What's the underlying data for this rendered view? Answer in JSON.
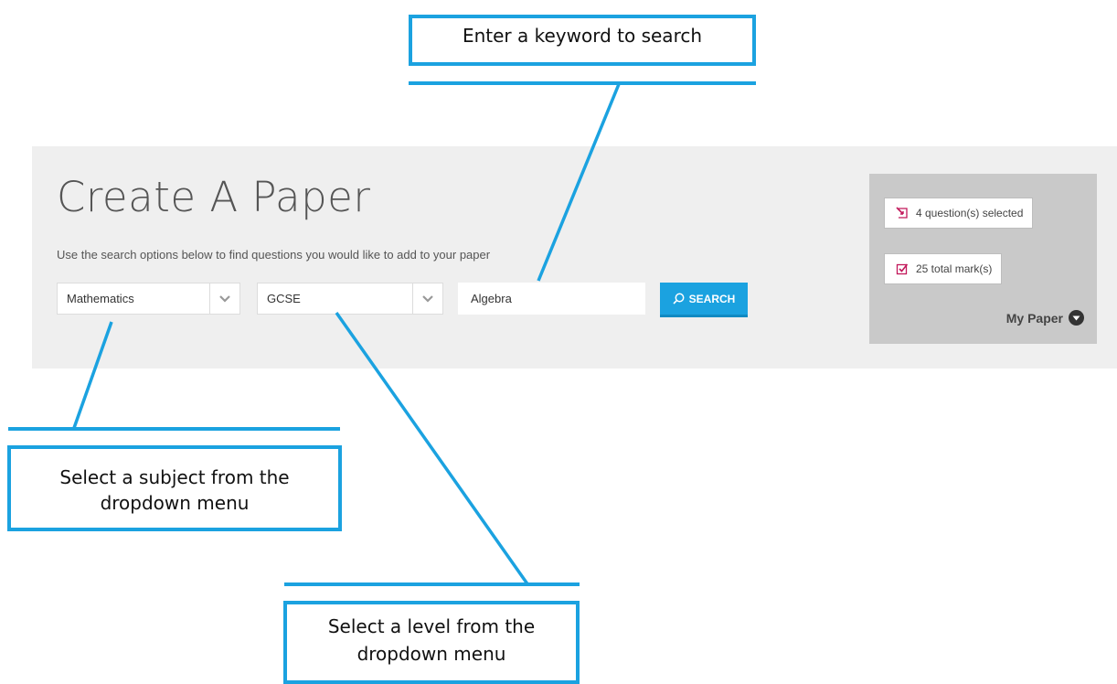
{
  "page": {
    "title": "Create A Paper",
    "subtitle": "Use the search options below to find questions you would like to add to your paper"
  },
  "filters": {
    "subject": {
      "selected": "Mathematics",
      "icon": "chevron-down-icon"
    },
    "level": {
      "selected": "GCSE",
      "icon": "chevron-down-icon"
    },
    "keyword": {
      "value": "Algebra"
    },
    "search_button": {
      "label": "SEARCH",
      "icon": "search-icon"
    }
  },
  "my_paper": {
    "questions_selected": "4 question(s) selected",
    "total_marks": "25 total mark(s)",
    "label": "My Paper",
    "questions_icon": "question-icon",
    "marks_icon": "checkbox-icon",
    "toggle_icon": "chevron-circle-down-icon"
  },
  "callouts": {
    "keyword": "Enter a keyword to search",
    "subject_line1": "Select a subject from the",
    "subject_line2": "dropdown menu",
    "level_line1": "Select a level from the",
    "level_line2": "dropdown menu"
  },
  "colors": {
    "accent": "#1ba2e0",
    "panel_bg": "#efefef",
    "my_paper_bg": "#c9c9c9",
    "icon_magenta": "#c2185b"
  }
}
